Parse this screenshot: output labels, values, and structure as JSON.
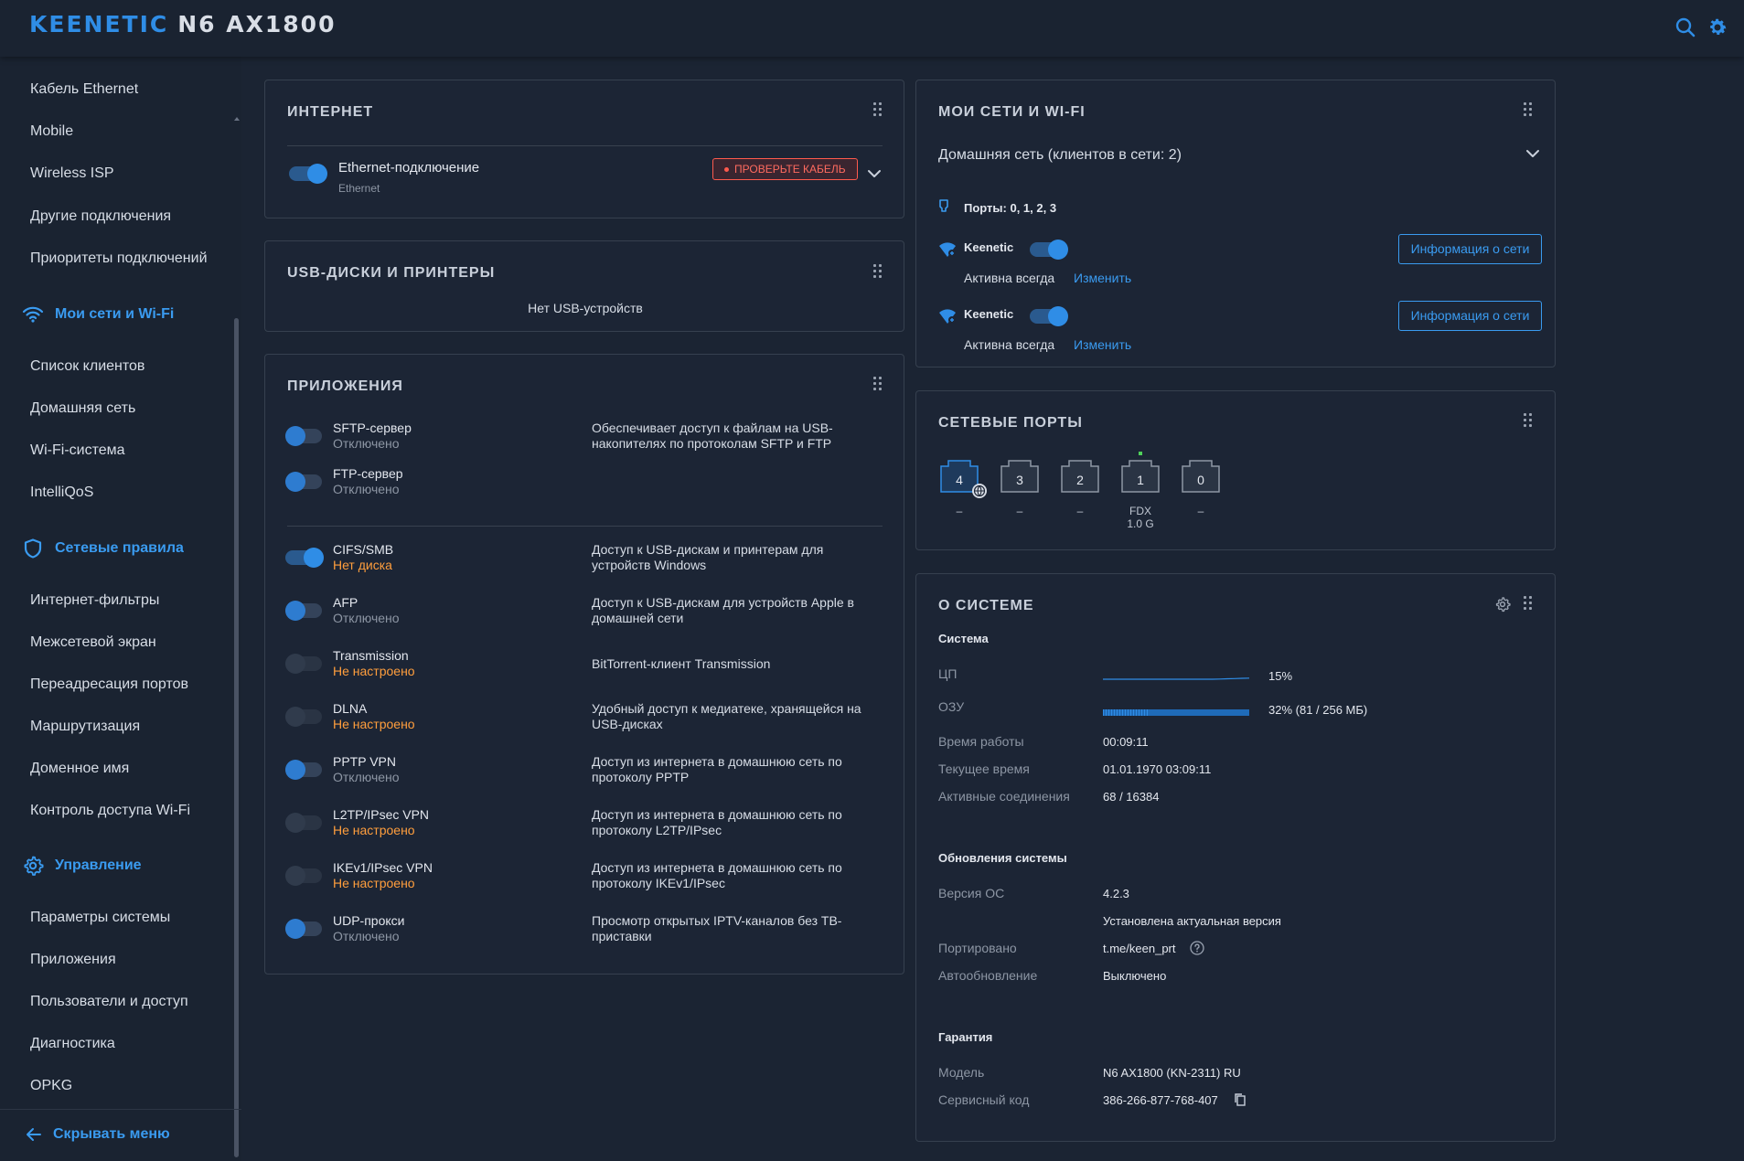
{
  "header": {
    "brand_name": "KEENETIC",
    "brand_model": "N6 AX1800",
    "search_icon": "search-icon",
    "settings_icon": "gear-icon"
  },
  "sidebar": {
    "items_top": [
      "Кабель Ethernet",
      "Mobile",
      "Wireless ISP",
      "Другие подключения",
      "Приоритеты подключений"
    ],
    "section_wifi": {
      "label": "Мои сети и Wi-Fi",
      "icon": "wifi-icon"
    },
    "items_wifi": [
      "Список клиентов",
      "Домашняя сеть",
      "Wi-Fi-система",
      "IntelliQoS"
    ],
    "section_rules": {
      "label": "Сетевые правила",
      "icon": "shield-icon"
    },
    "items_rules": [
      "Интернет-фильтры",
      "Межсетевой экран",
      "Переадресация портов",
      "Маршрутизация",
      "Доменное имя",
      "Контроль доступа Wi-Fi"
    ],
    "section_manage": {
      "label": "Управление",
      "icon": "gear-icon"
    },
    "items_manage": [
      "Параметры системы",
      "Приложения",
      "Пользователи и доступ",
      "Диагностика",
      "OPKG"
    ],
    "hide_menu": "Скрывать меню"
  },
  "internet": {
    "title": "ИНТЕРНЕТ",
    "connection_name": "Ethernet-подключение",
    "connection_type": "Ethernet",
    "enabled": true,
    "badge": "ПРОВЕРЬТЕ КАБЕЛЬ"
  },
  "usb": {
    "title": "USB-ДИСКИ И ПРИНТЕРЫ",
    "empty_text": "Нет USB-устройств"
  },
  "apps": {
    "title": "ПРИЛОЖЕНИЯ",
    "items": [
      {
        "name": "SFTP-сервер",
        "status": "Отключено",
        "state": "off",
        "desc1": "Обеспечивает доступ к файлам на USB-",
        "desc2": "накопителях по протоколам SFTP и FTP"
      },
      {
        "name": "FTP-сервер",
        "status": "Отключено",
        "state": "off",
        "desc1": "",
        "desc2": ""
      },
      {
        "name": "CIFS/SMB",
        "status": "Нет диска",
        "state": "on",
        "desc1": "Доступ к USB-дискам и принтерам для",
        "desc2": "устройств Windows"
      },
      {
        "name": "AFP",
        "status": "Отключено",
        "state": "off",
        "desc1": "Доступ к USB-дискам для устройств Apple в",
        "desc2": "домашней сети"
      },
      {
        "name": "Transmission",
        "status": "Не настроено",
        "state": "dis",
        "desc1": "BitTorrent-клиент Transmission",
        "desc2": ""
      },
      {
        "name": "DLNA",
        "status": "Не настроено",
        "state": "dis",
        "desc1": "Удобный доступ к медиатеке, хранящейся на",
        "desc2": "USB-дисках"
      },
      {
        "name": "PPTP VPN",
        "status": "Отключено",
        "state": "off",
        "desc1": "Доступ из интернета в домашнюю сеть по",
        "desc2": "протоколу PPTP"
      },
      {
        "name": "L2TP/IPsec VPN",
        "status": "Не настроено",
        "state": "dis",
        "desc1": "Доступ из интернета в домашнюю сеть по",
        "desc2": "протоколу L2TP/IPsec"
      },
      {
        "name": "IKEv1/IPsec VPN",
        "status": "Не настроено",
        "state": "dis",
        "desc1": "Доступ из интернета в домашнюю сеть по",
        "desc2": "протоколу IKEv1/IPsec"
      },
      {
        "name": "UDP-прокси",
        "status": "Отключено",
        "state": "off",
        "desc1": "Просмотр открытых IPTV-каналов без ТВ-",
        "desc2": "приставки"
      }
    ]
  },
  "wifi": {
    "title": "МОИ СЕТИ И WI-FI",
    "home_network": "Домашняя сеть (клиентов в сети: 2)",
    "ports_label": "Порты: 0, 1, 2, 3",
    "networks": [
      {
        "ssid": "Keenetic",
        "schedule": "Активна всегда",
        "change": "Изменить",
        "info_button": "Информация о сети",
        "enabled": true
      },
      {
        "ssid": "Keenetic",
        "schedule": "Активна всегда",
        "change": "Изменить",
        "info_button": "Информация о сети",
        "enabled": true
      }
    ]
  },
  "ports": {
    "title": "СЕТЕВЫЕ ПОРТЫ",
    "list": [
      {
        "num": "4",
        "status": "–",
        "wan": true
      },
      {
        "num": "3",
        "status": "–"
      },
      {
        "num": "2",
        "status": "–"
      },
      {
        "num": "1",
        "status": "FDX",
        "speed": "1.0 G",
        "link": true
      },
      {
        "num": "0",
        "status": "–"
      }
    ]
  },
  "system": {
    "title": "О СИСТЕМЕ",
    "sec_system": "Система",
    "cpu_label": "ЦП",
    "cpu_value": "15%",
    "cpu_percent": 15,
    "ram_label": "ОЗУ",
    "ram_value": "32% (81 / 256 МБ)",
    "ram_percent": 32,
    "uptime_label": "Время работы",
    "uptime_value": "00:09:11",
    "time_label": "Текущее время",
    "time_value": "01.01.1970 03:09:11",
    "conn_label": "Активные соединения",
    "conn_value": "68 / 16384",
    "sec_updates": "Обновления системы",
    "os_label": "Версия ОС",
    "os_value": "4.2.3",
    "os_status": "Установлена актуальная версия",
    "ported_label": "Портировано",
    "ported_value": "t.me/keen_prt",
    "autoupdate_label": "Автообновление",
    "autoupdate_value": "Выключено",
    "sec_warranty": "Гарантия",
    "model_label": "Модель",
    "model_value": "N6 AX1800 (KN-2311) RU",
    "service_label": "Сервисный код",
    "service_value": "386-266-877-768-407"
  },
  "colors": {
    "accent": "#2f8de6",
    "warning": "#ff9e3d",
    "error": "#ff5a4d",
    "background": "#1b2433"
  }
}
